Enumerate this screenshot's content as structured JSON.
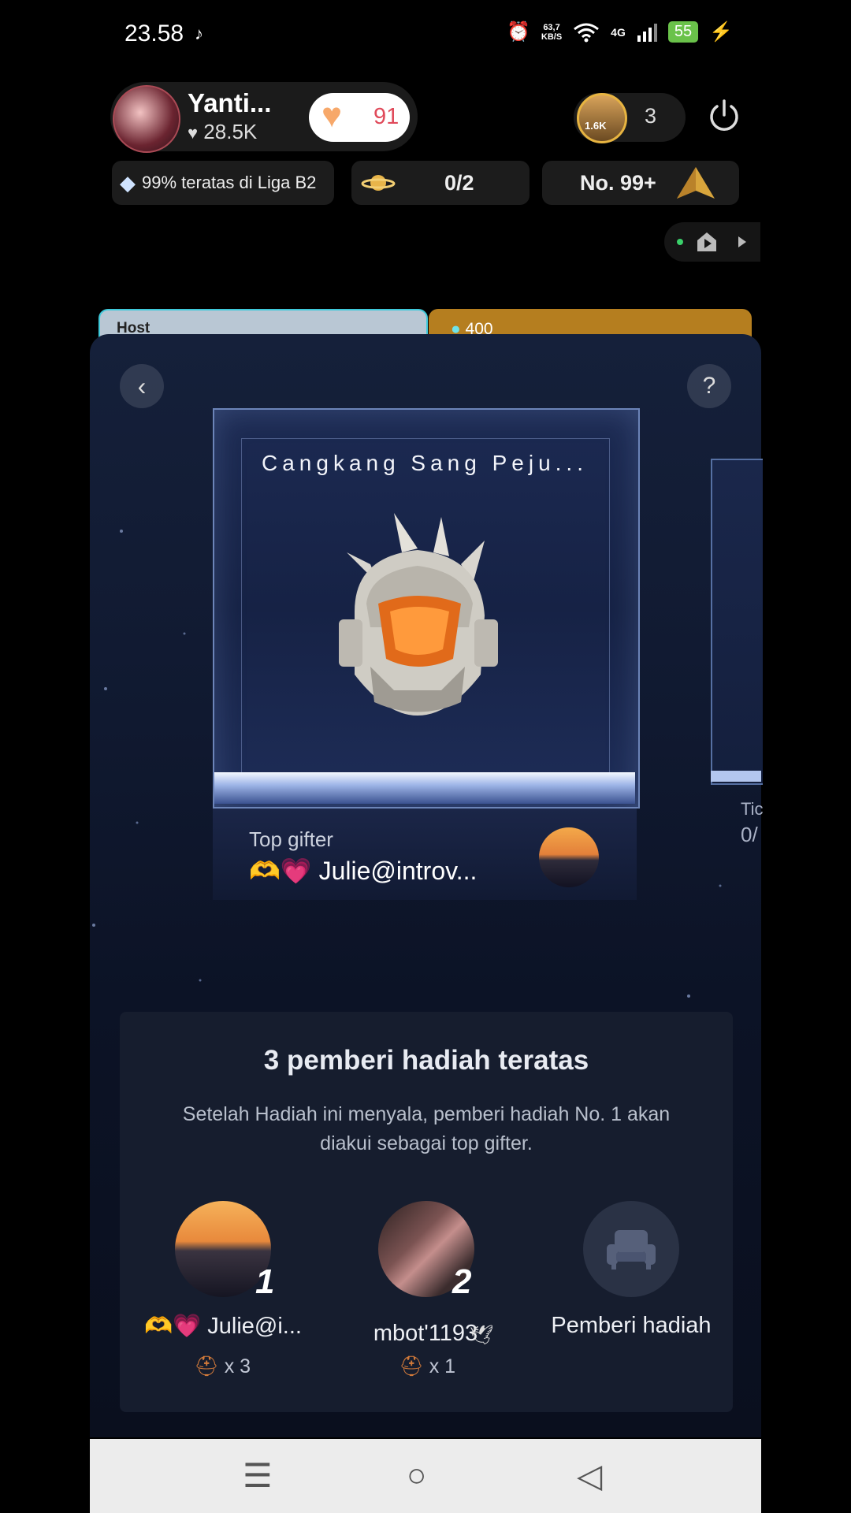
{
  "status_bar": {
    "time": "23.58",
    "speed_top": "63,7",
    "speed_bottom": "KB/S",
    "network": "4G",
    "battery": "55"
  },
  "host": {
    "name": "Yanti...",
    "likes": "28.5K"
  },
  "like_button": {
    "count": "91"
  },
  "viewers": {
    "badge": "1.6K",
    "count": "3"
  },
  "badges": {
    "league": "99% teratas di Liga B2",
    "progress": "0/2",
    "rank": "No. 99+"
  },
  "tabs": {
    "host": "Host",
    "gift_value": "400"
  },
  "showcase": {
    "title": "Cangkang Sang Peju...",
    "top_gifter_label": "Top gifter",
    "top_gifter_emoji": "🫶💗",
    "top_gifter_name": "Julie@introv...",
    "side_label": "Tic",
    "side_count": "0/"
  },
  "top_gifters": {
    "title": "3 pemberi hadiah teratas",
    "description": "Setelah Hadiah ini menyala, pemberi hadiah No. 1 akan diakui sebagai top gifter.",
    "ranks": [
      {
        "rank": "1",
        "name": "🫶💗 Julie@i...",
        "gift_count": "x 3"
      },
      {
        "rank": "2",
        "name": "mbot'1193",
        "gift_count": "x 1"
      },
      {
        "rank": "",
        "name": "Pemberi hadiah",
        "gift_count": ""
      }
    ]
  },
  "colors": {
    "accent_gold": "#e7b441",
    "like_red": "#e04a5a",
    "sheet_bg": "#101930"
  }
}
